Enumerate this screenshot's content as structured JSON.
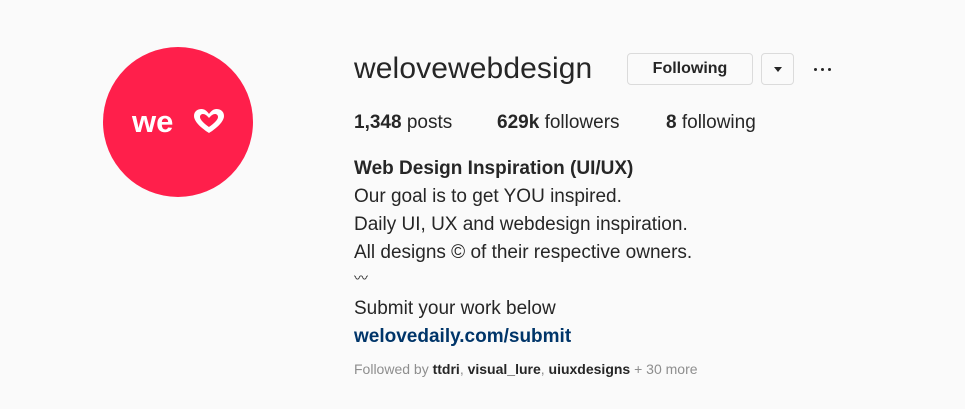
{
  "profile": {
    "username": "welovewebdesign",
    "avatar_color": "#ff1f4b",
    "avatar_text": "we"
  },
  "actions": {
    "following_label": "Following",
    "dropdown_icon": "chevron-down-icon",
    "more_icon": "ellipsis-icon"
  },
  "stats": {
    "posts_count": "1,348",
    "posts_label": "posts",
    "followers_count": "629k",
    "followers_label": "followers",
    "following_count": "8",
    "following_label": "following"
  },
  "bio": {
    "name": "Web Design Inspiration (UI/UX)",
    "line1": "Our goal is to get YOU inspired.",
    "line2": "Daily UI, UX and webdesign inspiration.",
    "line3": "All designs © of their respective owners.",
    "wave": "〰",
    "line4": "Submit your work below",
    "link": "welovedaily.com/submit",
    "link_color": "#003569"
  },
  "followed_by": {
    "prefix": "Followed by",
    "users": [
      "ttdri",
      "visual_lure",
      "uiuxdesigns"
    ],
    "more": "+ 30 more"
  }
}
